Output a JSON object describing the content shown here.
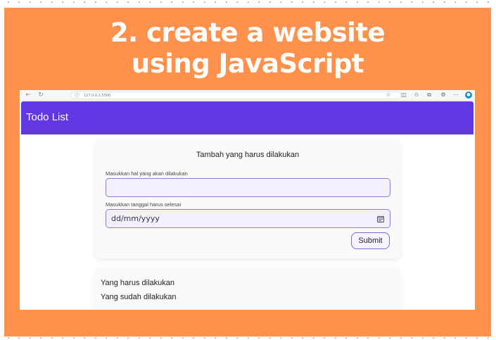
{
  "headline": {
    "line1": "2. create a website",
    "line2": "using JavaScript"
  },
  "colors": {
    "banner": "#ff914d",
    "appbar": "#6136e3",
    "input_bg": "#f5f0ff",
    "input_border": "#8f79e0"
  },
  "browser": {
    "url": "127.0.0.1:5500",
    "nav_icons": [
      "back-icon",
      "refresh-icon"
    ],
    "toolbar_icons": [
      "favorite-star-icon",
      "split-screen-icon",
      "favorites-icon",
      "collections-icon",
      "extensions-icon",
      "more-icon",
      "profile-icon"
    ]
  },
  "app": {
    "title": "Todo List"
  },
  "form": {
    "title": "Tambah yang harus dilakukan",
    "task_label": "Masukkan hal yang akan dilakukan",
    "task_value": "",
    "date_label": "Masukkan tanggal harus selesai",
    "date_placeholder": "dd/mm/yyyy",
    "submit_label": "Submit"
  },
  "lists": {
    "todo_heading": "Yang harus dilakukan",
    "done_heading": "Yang sudah dilakukan"
  }
}
